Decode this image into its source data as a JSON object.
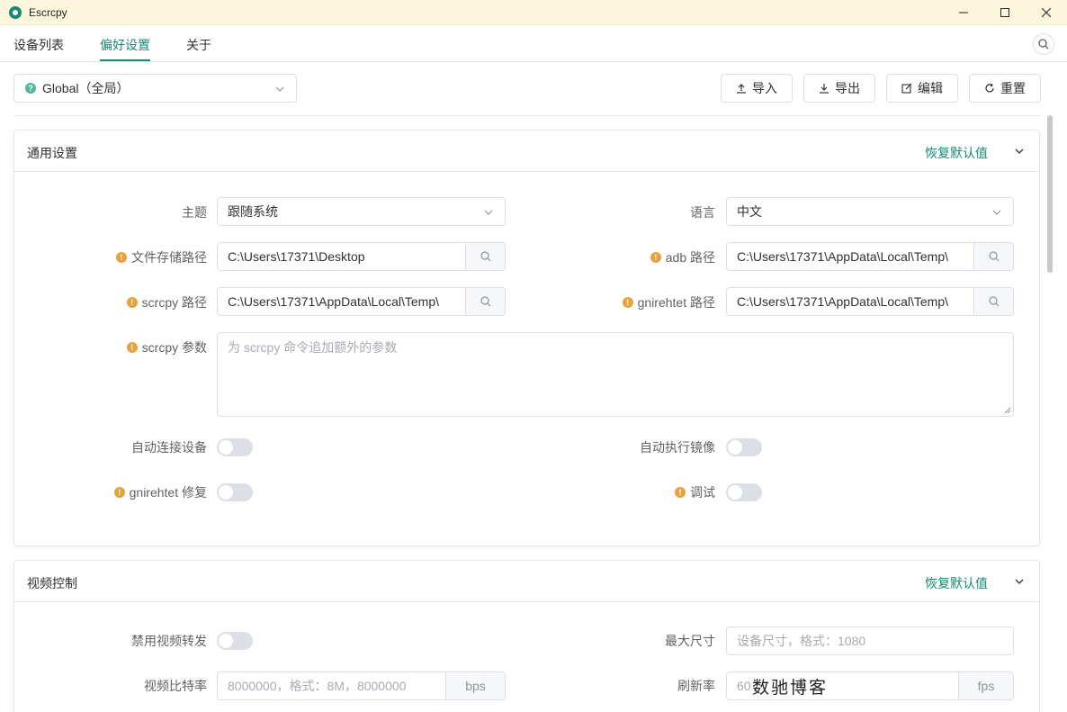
{
  "window": {
    "title": "Escrcpy"
  },
  "tabs": [
    {
      "label": "设备列表",
      "active": false
    },
    {
      "label": "偏好设置",
      "active": true
    },
    {
      "label": "关于",
      "active": false
    }
  ],
  "preset": {
    "value": "Global（全局）"
  },
  "toolbar": {
    "import": "导入",
    "export": "导出",
    "edit": "编辑",
    "reset": "重置"
  },
  "general": {
    "title": "通用设置",
    "restore": "恢复默认值",
    "theme_label": "主题",
    "theme_value": "跟随系统",
    "language_label": "语言",
    "language_value": "中文",
    "save_path_label": "文件存储路径",
    "save_path_value": "C:\\Users\\17371\\Desktop",
    "adb_path_label": "adb 路径",
    "adb_path_value": "C:\\Users\\17371\\AppData\\Local\\Temp\\",
    "scrcpy_path_label": "scrcpy 路径",
    "scrcpy_path_value": "C:\\Users\\17371\\AppData\\Local\\Temp\\",
    "gnirehtet_path_label": "gnirehtet 路径",
    "gnirehtet_path_value": "C:\\Users\\17371\\AppData\\Local\\Temp\\",
    "scrcpy_args_label": "scrcpy 参数",
    "scrcpy_args_placeholder": "为 scrcpy 命令追加额外的参数",
    "auto_connect_label": "自动连接设备",
    "auto_connect_on": false,
    "auto_mirror_label": "自动执行镜像",
    "auto_mirror_on": false,
    "gnirehtet_fix_label": "gnirehtet 修复",
    "gnirehtet_fix_on": false,
    "debug_label": "调试",
    "debug_on": false
  },
  "video": {
    "title": "视频控制",
    "restore": "恢复默认值",
    "disable_video_label": "禁用视频转发",
    "disable_video_on": false,
    "max_size_label": "最大尺寸",
    "max_size_placeholder": "设备尺寸，格式：1080",
    "bitrate_label": "视频比特率",
    "bitrate_placeholder": "8000000，格式：8M，8000000",
    "bitrate_unit": "bps",
    "fps_label": "刷新率",
    "fps_placeholder": "60",
    "fps_unit": "fps"
  },
  "watermark": "数驰博客",
  "colors": {
    "accent": "#168a72",
    "titlebar": "#fbf6dc",
    "info": "#e6a23c"
  }
}
